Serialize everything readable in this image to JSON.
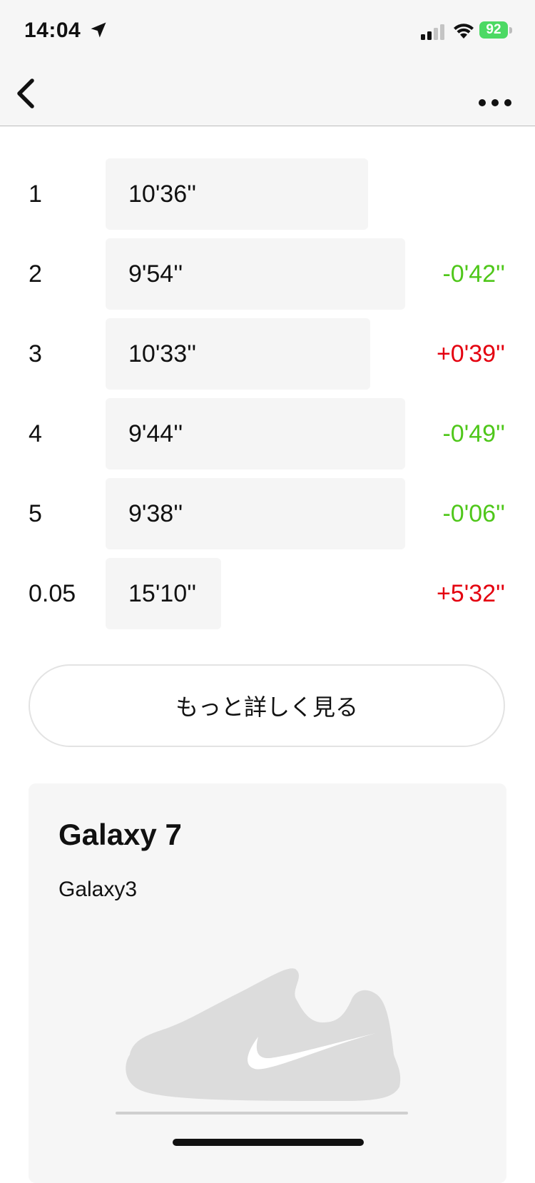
{
  "status_bar": {
    "time": "14:04",
    "battery": "92"
  },
  "splits": [
    {
      "index": "1",
      "time": "10'36''",
      "diff": "",
      "diff_sign": "none",
      "seconds": 636
    },
    {
      "index": "2",
      "time": "9'54''",
      "diff": "-0'42''",
      "diff_sign": "neg",
      "seconds": 594
    },
    {
      "index": "3",
      "time": "10'33''",
      "diff": "+0'39''",
      "diff_sign": "pos",
      "seconds": 633
    },
    {
      "index": "4",
      "time": "9'44''",
      "diff": "-0'49''",
      "diff_sign": "neg",
      "seconds": 584
    },
    {
      "index": "5",
      "time": "9'38''",
      "diff": "-0'06''",
      "diff_sign": "neg",
      "seconds": 578
    },
    {
      "index": "0.05",
      "time": "15'10''",
      "diff": "+5'32''",
      "diff_sign": "pos",
      "seconds": 910
    }
  ],
  "more_button_label": "もっと詳しく見る",
  "shoe": {
    "name": "Galaxy 7",
    "nickname": "Galaxy3"
  },
  "colors": {
    "faster": "#4fc71a",
    "slower": "#e4000f",
    "battery": "#4cd964"
  },
  "icons": [
    "location-arrow-icon",
    "signal-icon",
    "wifi-icon",
    "battery-icon",
    "back-chevron-icon",
    "more-dots-icon",
    "shoe-icon"
  ]
}
